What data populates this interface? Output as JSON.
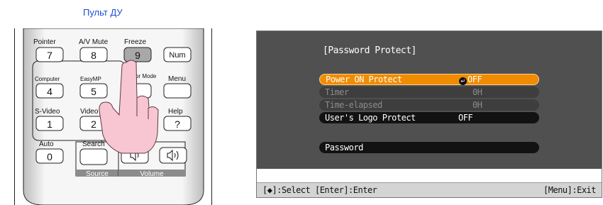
{
  "caption": "Пульт ДУ",
  "remote": {
    "keys": {
      "pointer": {
        "label": "Pointer",
        "key": "7"
      },
      "av_mute": {
        "label": "A/V Mute",
        "key": "8"
      },
      "freeze": {
        "label": "Freeze",
        "key": "9"
      },
      "num": {
        "key": "Num"
      },
      "computer": {
        "label": "Computer",
        "key": "4"
      },
      "easymp": {
        "label": "EasyMP",
        "key": "5"
      },
      "color_mode": {
        "label": "Color Mode"
      },
      "menu": {
        "label": "Menu"
      },
      "s_video": {
        "label": "S-Video",
        "key": "1"
      },
      "video": {
        "label": "Video",
        "key": "2"
      },
      "help": {
        "label": "Help",
        "key": "?"
      },
      "auto": {
        "label": "Auto",
        "key": "0"
      },
      "search": {
        "label": "Search"
      }
    },
    "source_label": "Source",
    "volume_label": "Volume"
  },
  "menu": {
    "title": "[Password Protect]",
    "rows": [
      {
        "label": "Power ON Protect",
        "value": "OFF",
        "state": "selected"
      },
      {
        "label": "Timer",
        "value": "0H",
        "state": "disabled"
      },
      {
        "label": "Time-elapsed",
        "value": "0H",
        "state": "disabled"
      },
      {
        "label": "User's Logo Protect",
        "value": "OFF",
        "state": "normal"
      },
      {
        "label": "Password",
        "value": "",
        "state": "normal"
      }
    ],
    "help_left": "[◆]:Select [Enter]:Enter",
    "help_right": "[Menu]:Exit"
  },
  "colors": {
    "selected": "#f08c00",
    "menu_bg": "#505050",
    "caption": "#1a4fd6"
  }
}
